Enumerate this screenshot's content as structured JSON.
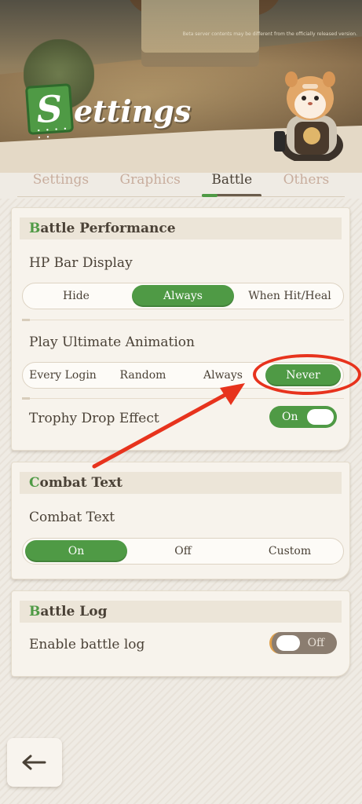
{
  "header": {
    "beta_note": "Beta server contents may be different from the officially released version.",
    "title_initial": "S",
    "title_rest": "ettings",
    "title_dots": "• • • • • •"
  },
  "tabs": [
    {
      "label": "Settings",
      "active": false
    },
    {
      "label": "Graphics",
      "active": false
    },
    {
      "label": "Battle",
      "active": true
    },
    {
      "label": "Others",
      "active": false
    }
  ],
  "battle_performance": {
    "title_first": "B",
    "title_rest": "attle Performance",
    "hp_bar": {
      "label": "HP Bar Display",
      "options": [
        "Hide",
        "Always",
        "When Hit/Heal"
      ],
      "selected": "Always"
    },
    "ultimate": {
      "label": "Play Ultimate Animation",
      "options": [
        "Every Login",
        "Random",
        "Always",
        "Never"
      ],
      "selected": "Never"
    },
    "trophy": {
      "label": "Trophy Drop Effect",
      "state": "On"
    }
  },
  "combat_text": {
    "title_first": "C",
    "title_rest": "ombat Text",
    "label": "Combat Text",
    "options": [
      "On",
      "Off",
      "Custom"
    ],
    "selected": "On"
  },
  "battle_log": {
    "title_first": "B",
    "title_rest": "attle Log",
    "label": "Enable battle log",
    "state": "Off"
  },
  "colors": {
    "accent_green": "#4f9a45",
    "annotation_red": "#e7331d",
    "text_dark": "#4a4136",
    "tab_inactive": "#c8ad9d"
  },
  "icons": {
    "back": "back-arrow-icon"
  }
}
